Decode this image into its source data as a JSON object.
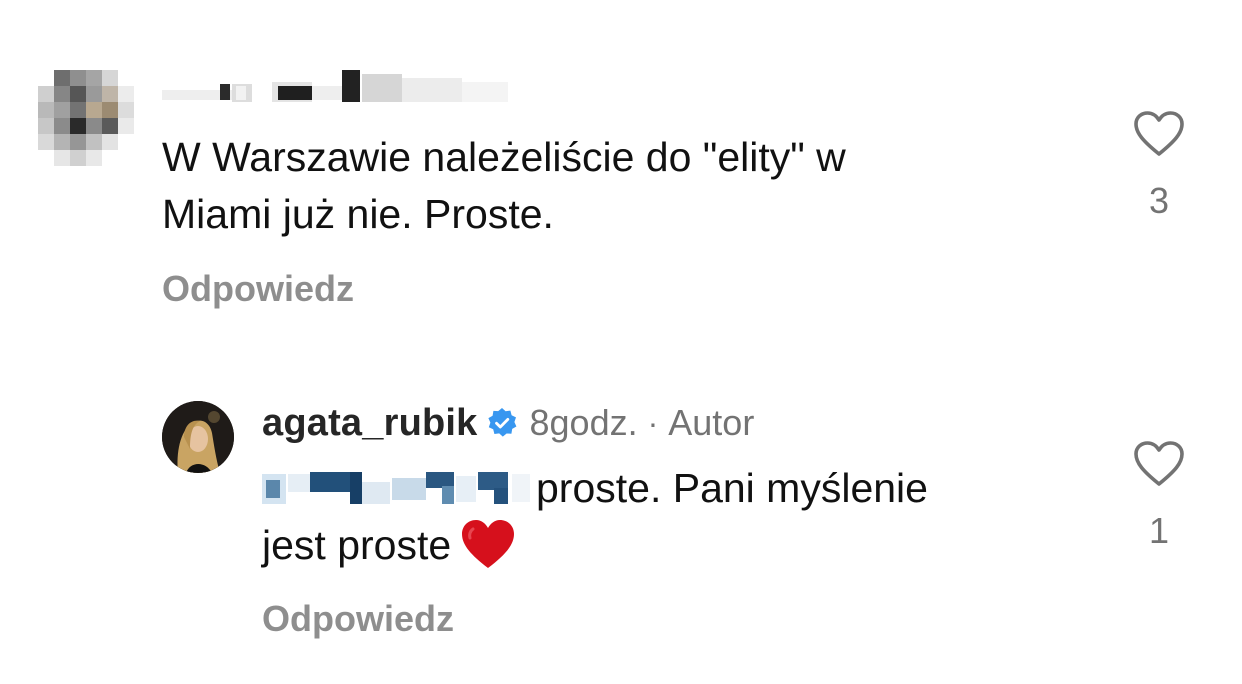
{
  "comments": [
    {
      "username": "",
      "time": "",
      "text_line1": "W Warszawie należeliście do \"elity\" w",
      "text_line2": "Miami już nie. Proste.",
      "reply_label": "Odpowiedz",
      "like_count": "3",
      "avatar_icon": "pixelated-avatar-icon"
    },
    {
      "username": "agata_rubik",
      "verified": true,
      "time": "8godz.",
      "separator": "·",
      "author_label": "Autor",
      "text_line1": "proste. Pani myślenie",
      "text_line2": "jest proste",
      "emoji": "red-heart",
      "reply_label": "Odpowiedz",
      "like_count": "1",
      "avatar_icon": "profile-photo-avatar"
    }
  ],
  "colors": {
    "text": "#111111",
    "secondary": "#737373",
    "reply": "#8e8e8e",
    "verified": "#3897f0",
    "heart_emoji": "#d6101c"
  }
}
